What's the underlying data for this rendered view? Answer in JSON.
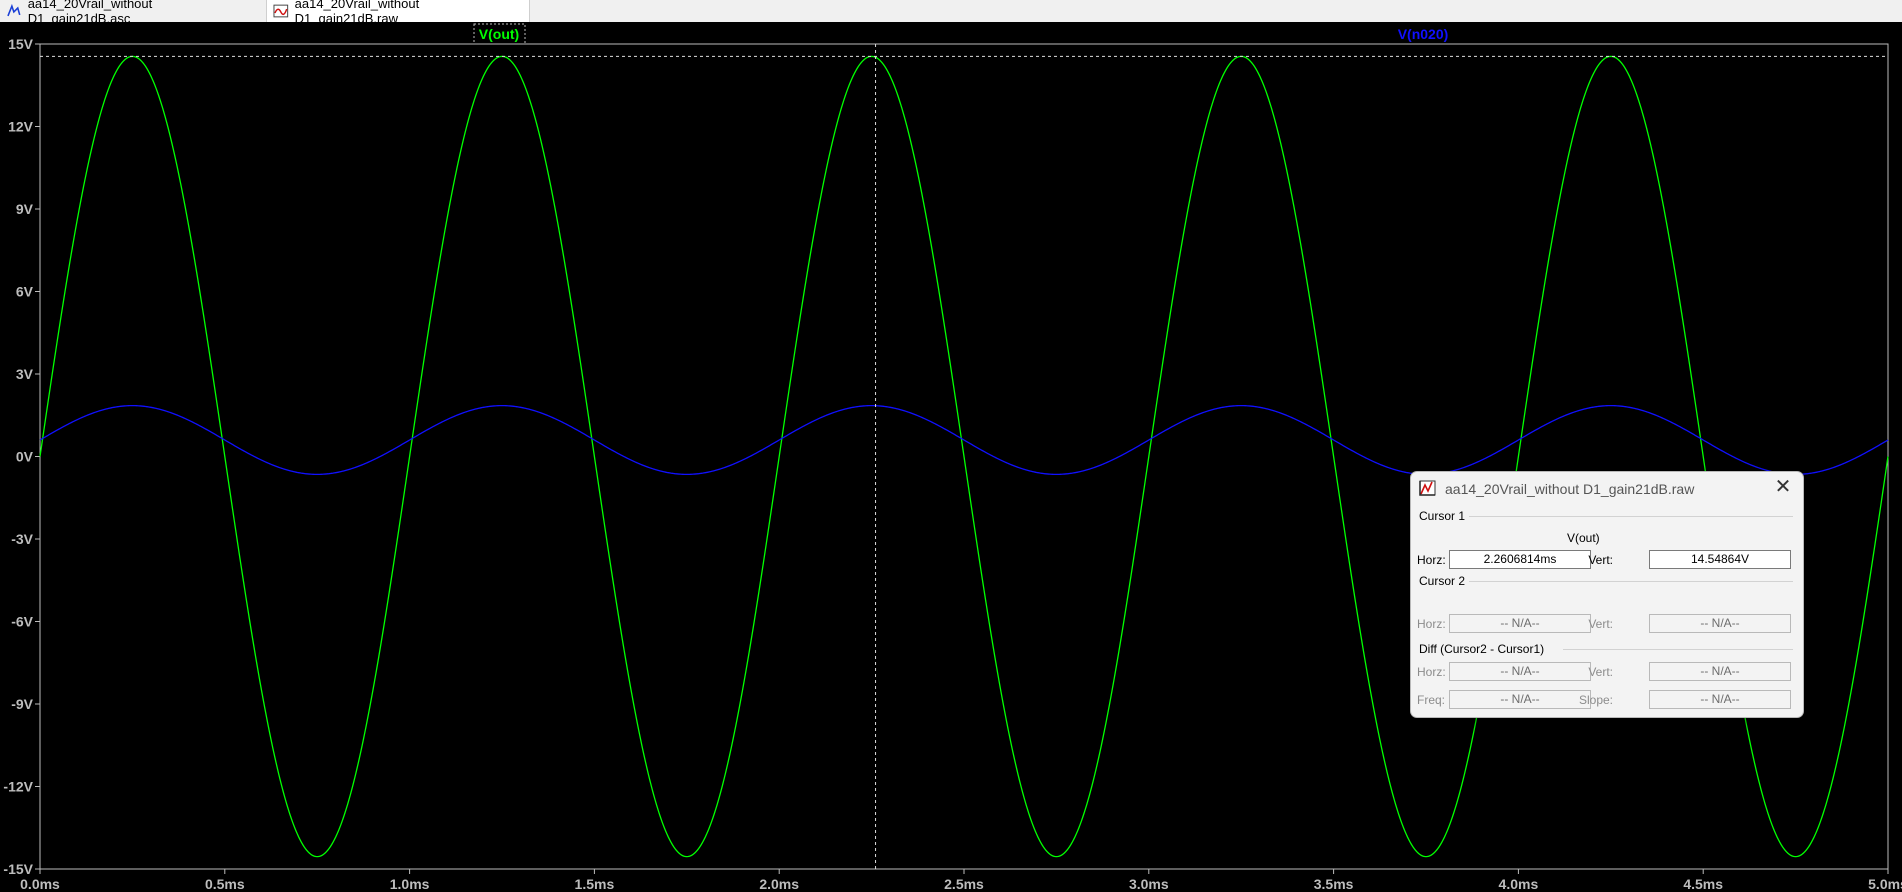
{
  "tabs": [
    {
      "label": "aa14_20Vrail_without D1_gain21dB.asc",
      "icon": "schematic-icon"
    },
    {
      "label": "aa14_20Vrail_without D1_gain21dB.raw",
      "icon": "waveform-icon"
    }
  ],
  "colors": {
    "background": "#000000",
    "trace_out": "#00ff00",
    "trace_n020": "#1010ff",
    "axis": "#c8c8c8",
    "text": "#e0e0e0"
  },
  "chart_data": {
    "type": "line",
    "xlabel": "",
    "ylabel": "",
    "xlim": [
      0,
      5.0
    ],
    "ylim": [
      -15,
      15
    ],
    "x_ticks": [
      "0.0ms",
      "0.5ms",
      "1.0ms",
      "1.5ms",
      "2.0ms",
      "2.5ms",
      "3.0ms",
      "3.5ms",
      "4.0ms",
      "4.5ms",
      "5.0ms"
    ],
    "y_ticks": [
      "15V",
      "12V",
      "9V",
      "6V",
      "3V",
      "0V",
      "-3V",
      "-6V",
      "-9V",
      "-12V",
      "-15V"
    ],
    "grid": false,
    "series": [
      {
        "name": "V(out)",
        "color": "#00ff00",
        "waveform": "sine",
        "offset": 0,
        "amplitude": 14.55,
        "frequency_khz": 1.0,
        "phase_deg": 0,
        "peak": 14.55,
        "trough": -14.55
      },
      {
        "name": "V(n020)",
        "color": "#1010ff",
        "waveform": "sine",
        "offset": 0.6,
        "amplitude": 1.25,
        "frequency_khz": 1.0,
        "phase_deg": 0,
        "peak": 1.85,
        "trough": -0.65
      }
    ],
    "cursor": {
      "x": 2.2606814,
      "y": 14.54864
    }
  },
  "cursor_dialog": {
    "title": "aa14_20Vrail_without D1_gain21dB.raw",
    "cursor1_label": "Cursor 1",
    "cursor1_trace": "V(out)",
    "horz_label": "Horz:",
    "vert_label": "Vert:",
    "cursor1_horz": "2.2606814ms",
    "cursor1_vert": "14.54864V",
    "cursor2_label": "Cursor 2",
    "cursor2_horz": "-- N/A--",
    "cursor2_vert": "-- N/A--",
    "diff_label": "Diff (Cursor2 - Cursor1)",
    "diff_horz": "-- N/A--",
    "diff_vert": "-- N/A--",
    "freq_label": "Freq:",
    "slope_label": "Slope:",
    "diff_freq": "-- N/A--",
    "diff_slope": "-- N/A--"
  }
}
